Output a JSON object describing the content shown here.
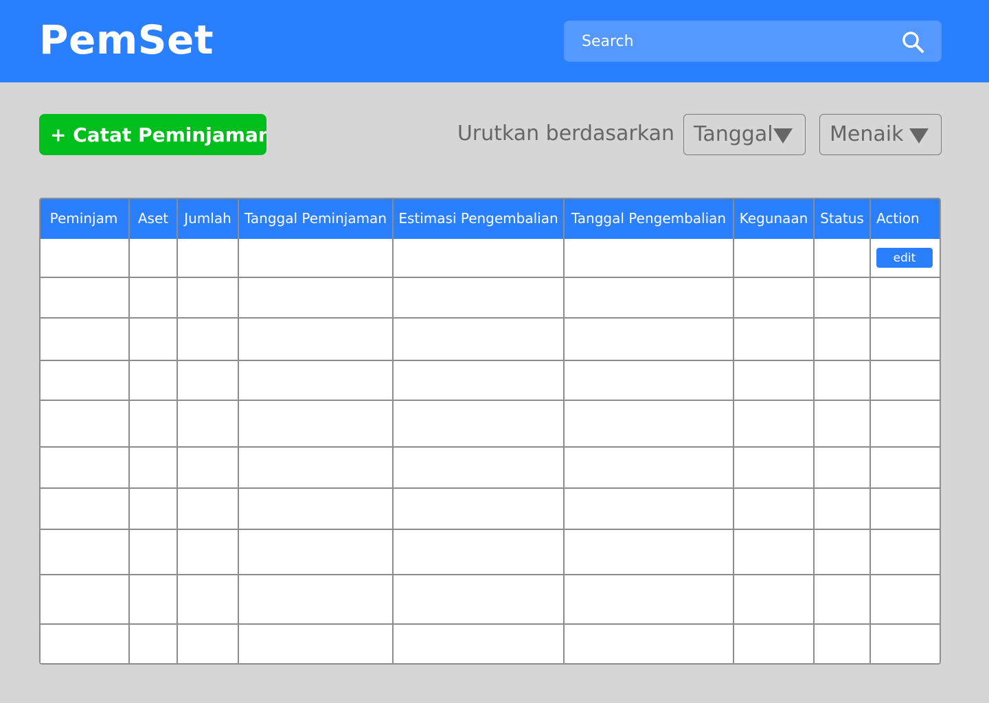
{
  "app": {
    "title": "PemSet"
  },
  "search": {
    "placeholder": "Search",
    "icon": "search-icon"
  },
  "toolbar": {
    "add_label": "+ Catat Peminjaman",
    "sort_label": "Urutkan berdasarkan",
    "sort_field": {
      "selected": "Tanggal"
    },
    "sort_order": {
      "selected": "Menaik"
    }
  },
  "table": {
    "headers": [
      "Peminjam",
      "Aset",
      "Jumlah",
      "Tanggal Peminjaman",
      "Estimasi Pengembalian",
      "Tanggal Pengembalian",
      "Kegunaan",
      "Status",
      "Action"
    ],
    "row_count": 10,
    "edit_label": "edit"
  },
  "colors": {
    "header_bg": "#2a7fff",
    "search_bg": "#5599ff",
    "add_button_bg": "#00bf1d",
    "page_bg": "#d6d6d6",
    "grid_line": "#8c8c8c"
  }
}
